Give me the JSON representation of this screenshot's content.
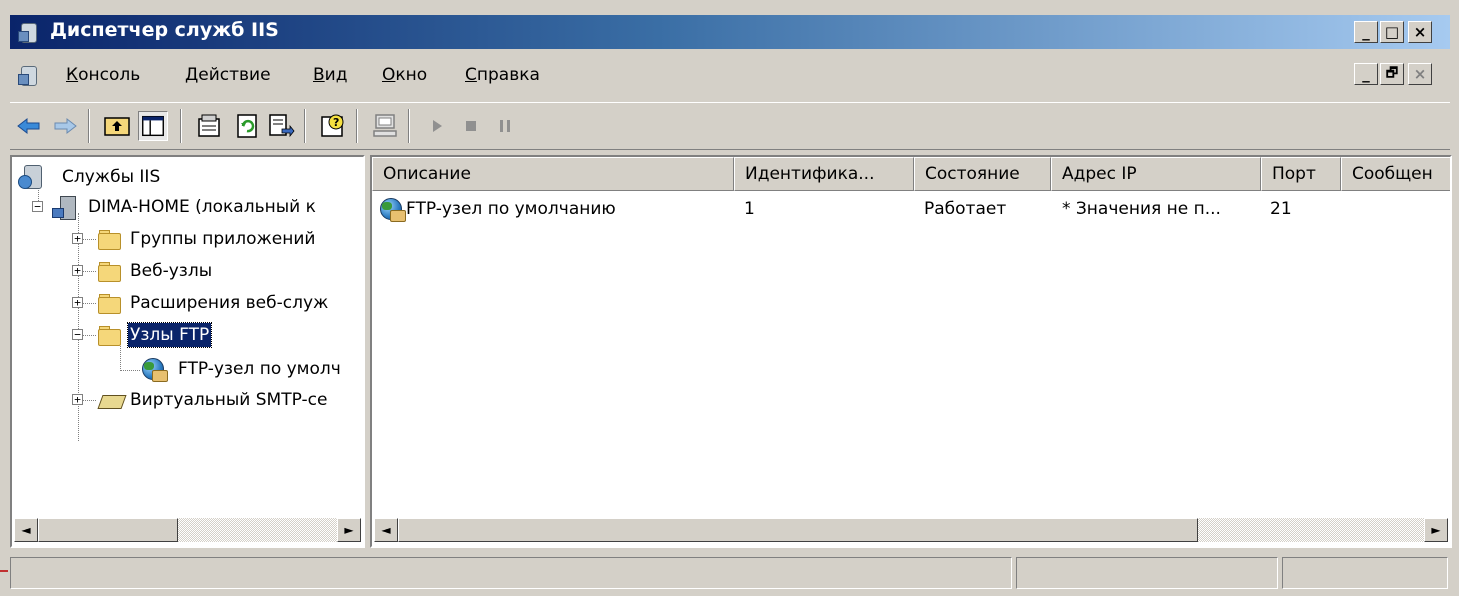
{
  "window": {
    "title": "Диспетчер служб IIS",
    "controls": [
      "_",
      "□",
      "×"
    ],
    "mdi_controls": [
      "_",
      "🗗",
      "×"
    ]
  },
  "menu": [
    {
      "pre": "",
      "ul": "К",
      "post": "онсоль"
    },
    {
      "pre": "",
      "ul": "Д",
      "post": "ействие"
    },
    {
      "pre": "",
      "ul": "В",
      "post": "ид"
    },
    {
      "pre": "",
      "ul": "О",
      "post": "кно"
    },
    {
      "pre": "",
      "ul": "С",
      "post": "правка"
    }
  ],
  "toolbar": {
    "buttons": [
      "back-icon",
      "forward-icon",
      "up-folder-icon",
      "show-tree-icon",
      "properties-icon",
      "refresh-icon",
      "export-icon",
      "help-icon",
      "connect-icon",
      "play-icon",
      "stop-icon",
      "pause-icon"
    ]
  },
  "tree": {
    "root": "Службы IIS",
    "server": "DIMA-HOME (локальный к",
    "items": [
      {
        "label": "Группы приложений",
        "expander": "+"
      },
      {
        "label": "Веб-узлы",
        "expander": "+"
      },
      {
        "label": "Расширения веб-служ",
        "expander": "+"
      },
      {
        "label": "Узлы FTP",
        "expander": "−"
      }
    ],
    "ftp_child": "FTP-узел по умолч",
    "smtp": "Виртуальный SMTP-се"
  },
  "list": {
    "columns": [
      "Описание",
      "Идентифика...",
      "Состояние",
      "Адрес IP",
      "Порт",
      "Сообщен"
    ],
    "rows": [
      [
        "FTP-узел по умолчанию",
        "1",
        "Работает",
        "* Значения не п...",
        "21",
        ""
      ]
    ]
  },
  "scroll": {
    "left": "◄",
    "right": "►"
  }
}
